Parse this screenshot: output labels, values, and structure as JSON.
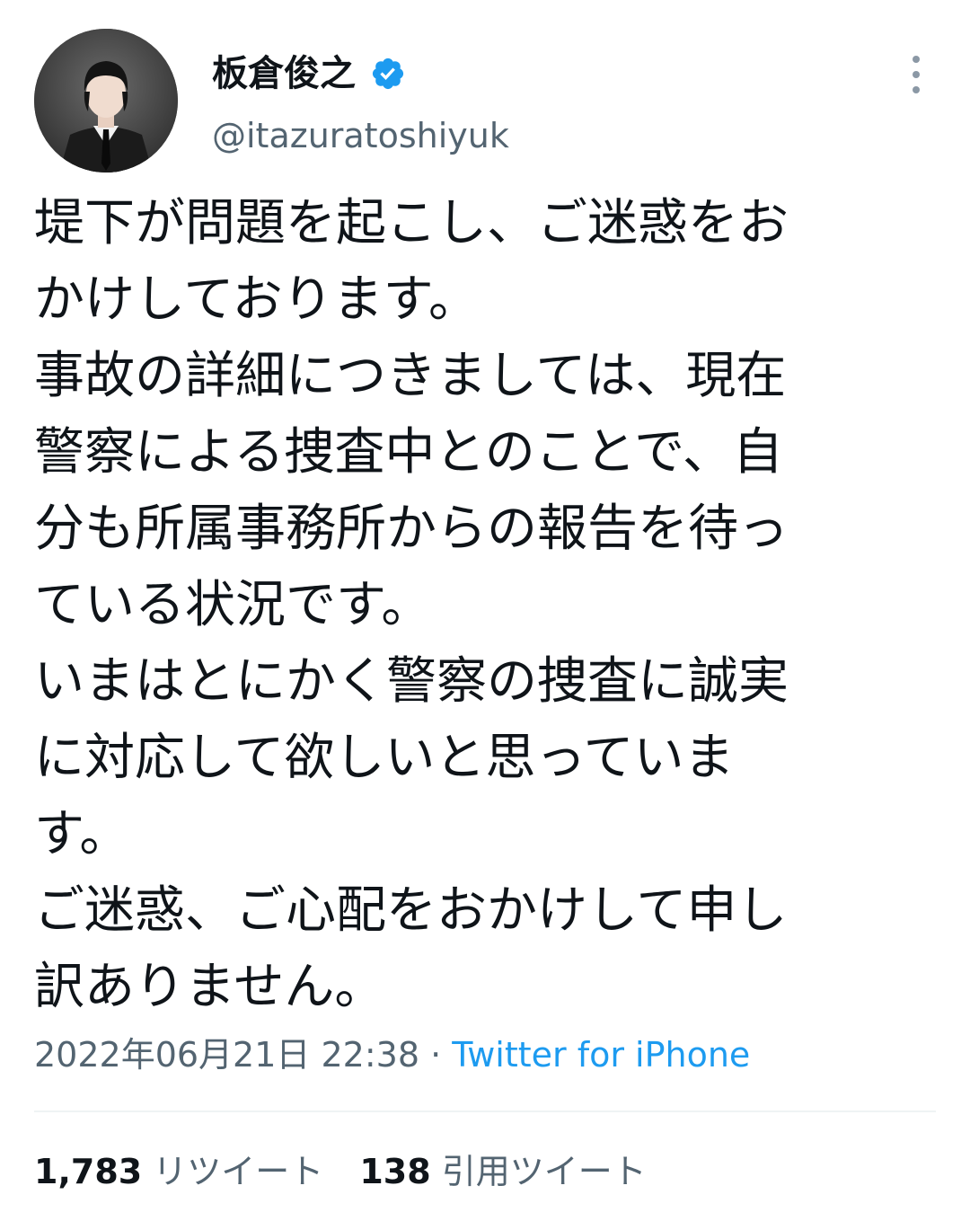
{
  "author": {
    "display_name": "板倉俊之",
    "handle": "@itazuratoshiyuk",
    "verified": true
  },
  "icons": {
    "verified": "verified-badge-icon",
    "more": "more-vertical-icon",
    "avatar": "avatar-image"
  },
  "tweet": {
    "lines": [
      "堤下が問題を起こし、ご迷惑をお",
      "かけしております。",
      "事故の詳細につきましては、現在",
      "警察による捜査中とのことで、自",
      "分も所属事務所からの報告を待っ",
      "ている状況です。",
      "いまはとにかく警察の捜査に誠実",
      "に対応して欲しいと思っていま",
      "す。",
      "ご迷惑、ご心配をおかけして申し",
      "訳ありません。"
    ],
    "timestamp": "2022年06月21日 22:38",
    "separator": " · ",
    "source": "Twitter for iPhone"
  },
  "stats": {
    "retweets_count": "1,783",
    "retweets_label": "リツイート",
    "quotes_count": "138",
    "quotes_label": "引用ツイート"
  },
  "colors": {
    "text_primary": "#0f1419",
    "text_secondary": "#536471",
    "accent": "#1d9bf0",
    "divider": "#eff3f4"
  }
}
